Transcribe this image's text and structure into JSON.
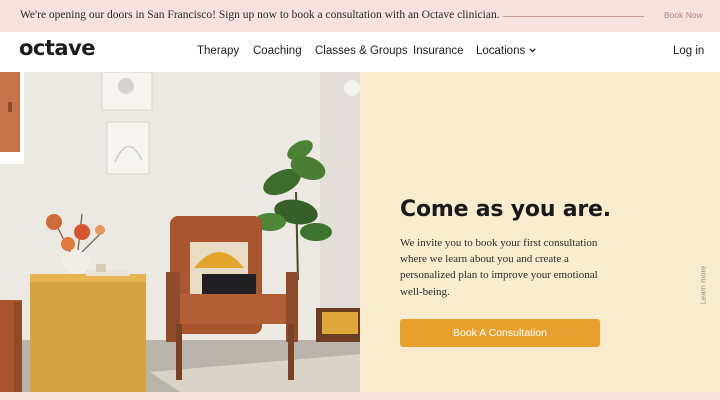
{
  "announcement": {
    "text": "We're opening our doors in San Francisco! Sign up now to book a consultation with an Octave clinician.",
    "link": "Book Now"
  },
  "nav": {
    "logo": "octave",
    "items": [
      {
        "label": "Therapy"
      },
      {
        "label": "Coaching"
      },
      {
        "label": "Classes & Groups"
      },
      {
        "label": "Insurance"
      },
      {
        "label": "Locations"
      }
    ],
    "login": "Log in"
  },
  "hero": {
    "title": "Come as you are.",
    "body": "We invite you to book your first consultation where we learn about you and create a personalized plan to improve your emotional well-being.",
    "cta": "Book A Consultation",
    "side_link": "Learn more"
  },
  "colors": {
    "announcement_bg": "#f7e2de",
    "hero_panel_bg": "#f8ebce",
    "cta_bg": "#e8a12e",
    "text": "#1c1c1c"
  },
  "icons": [
    "chevron-down-icon"
  ]
}
